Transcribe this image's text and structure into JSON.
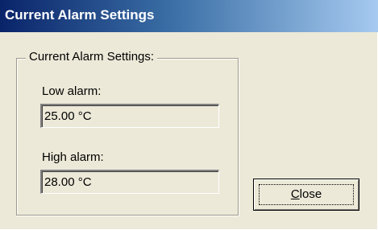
{
  "window": {
    "title": "Current Alarm Settings"
  },
  "group": {
    "legend": "Current Alarm Settings:"
  },
  "low_alarm": {
    "label": "Low alarm:",
    "value": "25.00 °C"
  },
  "high_alarm": {
    "label": "High alarm:",
    "value": "28.00 °C"
  },
  "close_button": {
    "mnemonic": "C",
    "rest": "lose"
  },
  "colors": {
    "titlebar_start": "#0a246a",
    "titlebar_end": "#a6caf0",
    "dialog_background": "#ece9d8"
  }
}
